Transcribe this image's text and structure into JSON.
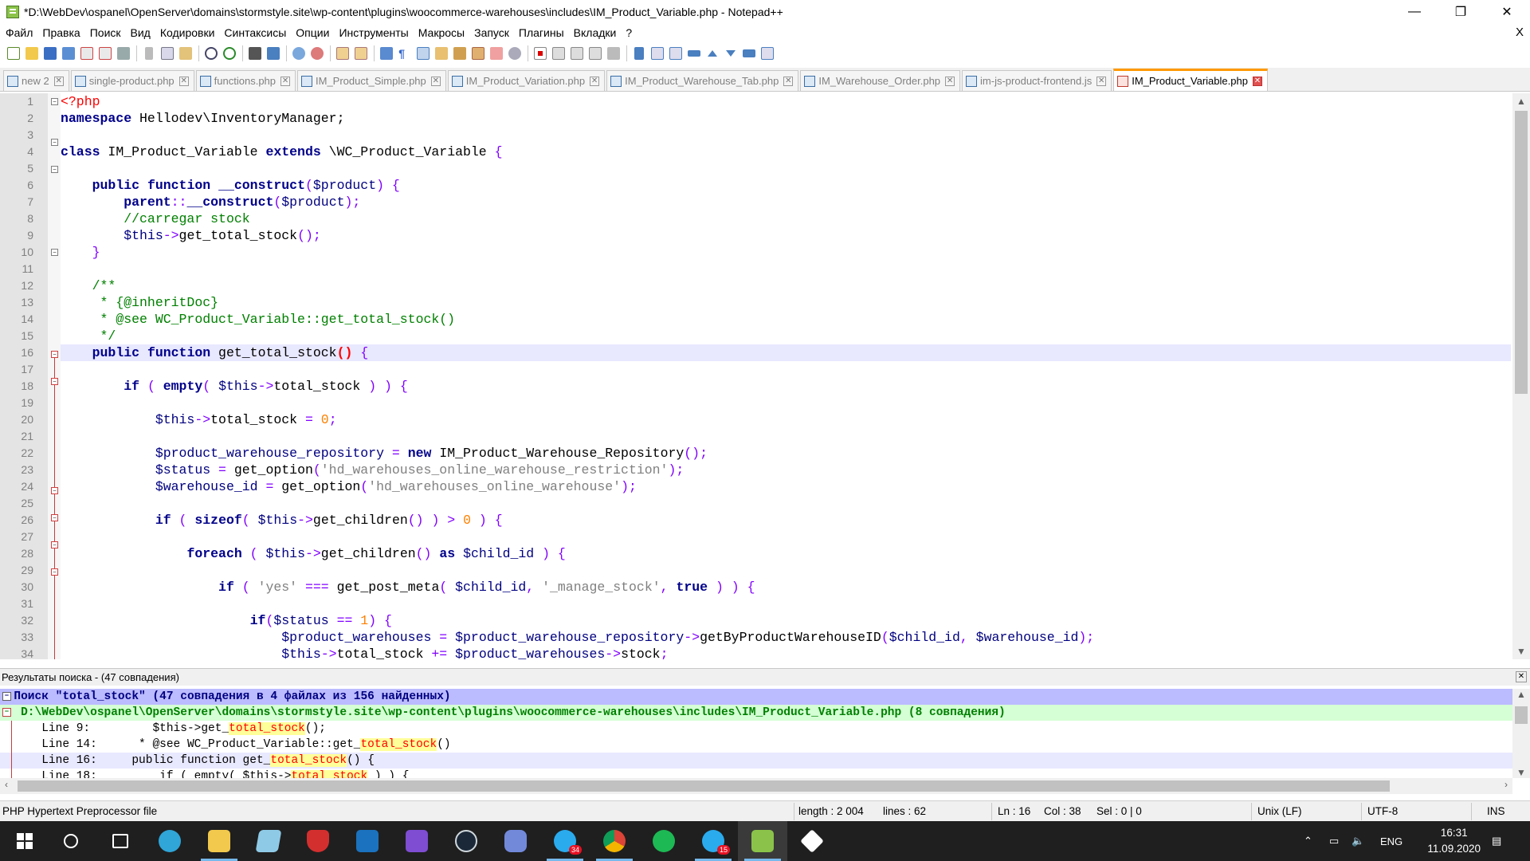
{
  "window": {
    "title": "*D:\\WebDev\\ospanel\\OpenServer\\domains\\stormstyle.site\\wp-content\\plugins\\woocommerce-warehouses\\includes\\IM_Product_Variable.php - Notepad++",
    "minimize": "—",
    "maximize": "❐",
    "close": "✕"
  },
  "menu": {
    "items": [
      "Файл",
      "Правка",
      "Поиск",
      "Вид",
      "Кодировки",
      "Синтаксисы",
      "Опции",
      "Инструменты",
      "Макросы",
      "Запуск",
      "Плагины",
      "Вкладки",
      "?"
    ],
    "close": "X"
  },
  "toolbar": {
    "icons": [
      "new-file-icon",
      "open-file-icon",
      "save-icon",
      "save-all-icon",
      "close-icon",
      "close-all-icon",
      "print-icon",
      "cut-icon",
      "copy-icon",
      "paste-icon",
      "undo-icon",
      "redo-icon",
      "find-icon",
      "replace-icon",
      "zoom-in-icon",
      "zoom-out-icon",
      "sync-v-icon",
      "sync-h-icon",
      "word-wrap-icon",
      "show-all-chars-icon",
      "indent-guide-icon",
      "doc-map-icon",
      "function-list-icon",
      "folder-workspace-icon",
      "monitoring-icon",
      "record-macro-icon",
      "stop-macro-icon",
      "play-macro-icon",
      "run-macro-multiple-icon",
      "save-macro-icon",
      "plugin-1-icon",
      "plugin-2-icon",
      "plugin-3-icon",
      "plugin-4-icon",
      "up-icon",
      "down-icon",
      "plugin-5-icon",
      "plugin-6-icon"
    ]
  },
  "tabs": [
    {
      "label": "new 2"
    },
    {
      "label": "single-product.php"
    },
    {
      "label": "functions.php"
    },
    {
      "label": "IM_Product_Simple.php"
    },
    {
      "label": "IM_Product_Variation.php"
    },
    {
      "label": "IM_Product_Warehouse_Tab.php"
    },
    {
      "label": "IM_Warehouse_Order.php"
    },
    {
      "label": "im-js-product-frontend.js"
    },
    {
      "label": "IM_Product_Variable.php",
      "active": true
    }
  ],
  "editor": {
    "line_numbers": [
      "1",
      "2",
      "3",
      "4",
      "5",
      "6",
      "7",
      "8",
      "9",
      "10",
      "11",
      "12",
      "13",
      "14",
      "15",
      "16",
      "17",
      "18",
      "19",
      "20",
      "21",
      "22",
      "23",
      "24",
      "25",
      "26",
      "27",
      "28",
      "29",
      "30",
      "31",
      "32",
      "33",
      "34"
    ],
    "current_line": 16
  },
  "results": {
    "header": "Результаты поиска - (47 совпадения)",
    "search_line": "Поиск \"total_stock\" (47 совпадения в 4 файлах из 156 найденных)",
    "file_line": "D:\\WebDev\\ospanel\\OpenServer\\domains\\stormstyle.site\\wp-content\\plugins\\woocommerce-warehouses\\includes\\IM_Product_Variable.php (8 совпадения)",
    "hits": [
      {
        "prefix": "Line 9:         $this->get_",
        "hit": "total_stock",
        "suffix": "();"
      },
      {
        "prefix": "Line 14:      * @see WC_Product_Variable::get_",
        "hit": "total_stock",
        "suffix": "()"
      },
      {
        "prefix": "Line 16:     public function get_",
        "hit": "total_stock",
        "suffix": "() {"
      },
      {
        "prefix": "Line 18:         if ( empty( $this->",
        "hit": "total_stock",
        "suffix": " ) ) {"
      }
    ]
  },
  "status": {
    "filetype": "PHP Hypertext Preprocessor file",
    "length": "length : 2 004",
    "lines": "lines : 62",
    "ln": "Ln : 16",
    "col": "Col : 38",
    "sel": "Sel : 0 | 0",
    "eol": "Unix (LF)",
    "encoding": "UTF-8",
    "mode": "INS"
  },
  "taskbar": {
    "apps": [
      "start-icon",
      "search-icon",
      "task-view-icon",
      "edge-icon",
      "file-explorer-icon",
      "notepad-icon",
      "vpn-shield-icon",
      "affinity-designer-icon",
      "affinity-photo-icon",
      "steam-icon",
      "discord-icon",
      "telegram-icon",
      "chrome-icon",
      "spotify-icon",
      "telegram-2-icon",
      "notepadpp-icon",
      "vscode-like-icon"
    ],
    "telegram_badge": "34",
    "telegram2_badge": "15",
    "lang": "ENG",
    "time": "16:31",
    "date": "11.09.2020"
  }
}
